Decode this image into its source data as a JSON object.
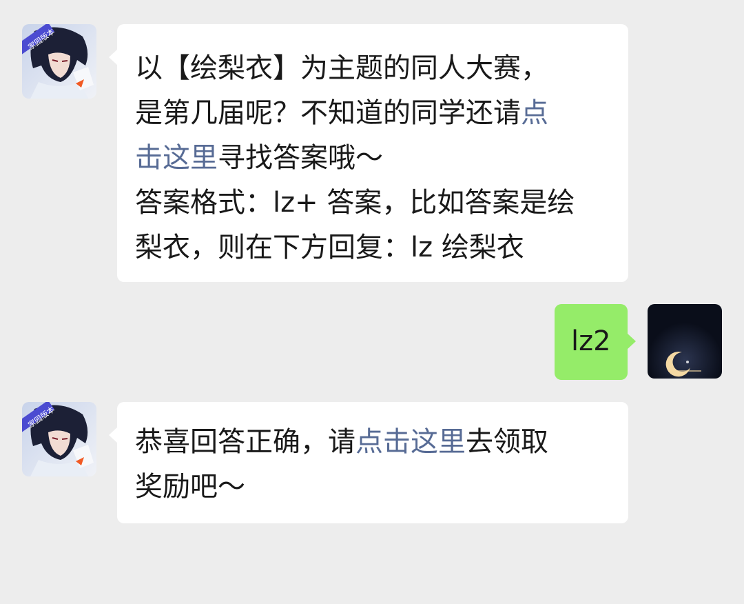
{
  "colors": {
    "background": "#ededed",
    "incoming_bubble": "#ffffff",
    "outgoing_bubble": "#95ec69",
    "link": "#576b95",
    "text": "#191919"
  },
  "messages": [
    {
      "direction": "incoming",
      "avatar_icon": "game-character-avatar-icon",
      "avatar_badge": "家园版本",
      "lines": [
        [
          "以【绘梨衣】为主题的同人大赛，"
        ],
        [
          "是第几届呢？不知道的同学还请",
          "点"
        ],
        [
          "击这里",
          "寻找答案哦～"
        ],
        [
          "答案格式：lz+ 答案，比如答案是绘"
        ],
        [
          "梨衣，则在下方回复：lz 绘梨衣"
        ]
      ]
    },
    {
      "direction": "outgoing",
      "avatar_icon": "moon-night-avatar-icon",
      "text": "lz2"
    },
    {
      "direction": "incoming",
      "avatar_icon": "game-character-avatar-icon",
      "avatar_badge": "家园版本",
      "lines": [
        [
          "恭喜回答正确，请",
          "点击这里",
          "去领取"
        ],
        [
          "奖励吧～"
        ]
      ]
    }
  ]
}
